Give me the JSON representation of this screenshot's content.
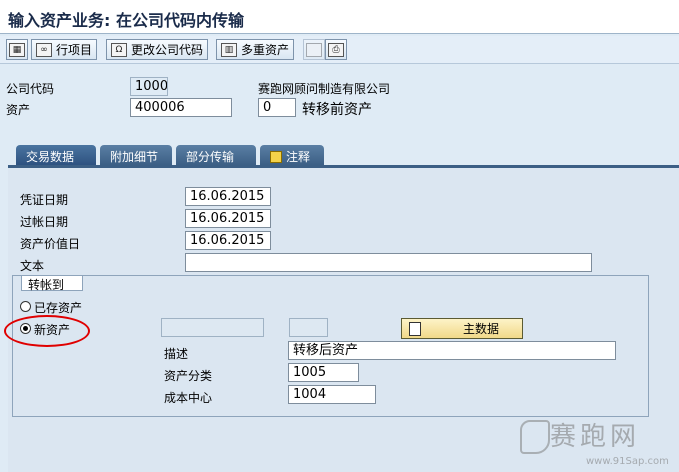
{
  "window": {
    "title": "输入资产业务: 在公司代码内传输"
  },
  "toolbar": {
    "items": [
      {
        "label": "",
        "icon": "overview-icon",
        "enabled": true
      },
      {
        "label": "行项目",
        "icon": "glasses-icon",
        "enabled": true
      },
      {
        "label": "更改公司代码",
        "icon": "headset-icon",
        "enabled": true
      },
      {
        "label": "多重资产",
        "icon": "grid-icon",
        "enabled": true
      },
      {
        "label": "",
        "icon": "disabled-icon",
        "enabled": false
      },
      {
        "label": "",
        "icon": "document-icon",
        "enabled": true
      }
    ]
  },
  "header": {
    "company_code_label": "公司代码",
    "company_code_value": "1000",
    "company_name": "赛跑网顾问制造有限公司",
    "asset_label": "资产",
    "asset_value": "400006",
    "sub_number_value": "0",
    "asset_before_transfer_label": "转移前资产"
  },
  "tabs": [
    {
      "label": "交易数据",
      "active": true
    },
    {
      "label": "附加细节",
      "active": false
    },
    {
      "label": "部分传输",
      "active": false
    },
    {
      "label": "注释",
      "active": false,
      "icon": "note-pencil-icon"
    }
  ],
  "transaction": {
    "document_date_label": "凭证日期",
    "document_date_value": "16.06.2015",
    "posting_date_label": "过帐日期",
    "posting_date_value": "16.06.2015",
    "asset_value_date_label": "资产价值日",
    "asset_value_date_value": "16.06.2015",
    "text_label": "文本",
    "text_value": ""
  },
  "transfer_to": {
    "group_title": "转帐到",
    "existing_asset_label": "已存资产",
    "new_asset_label": "新资产",
    "selected": "new_asset",
    "master_data_button": "主数据",
    "description_label": "描述",
    "description_value": "转移后资产",
    "asset_class_label": "资产分类",
    "asset_class_value": "1005",
    "cost_center_label": "成本中心",
    "cost_center_value": "1004"
  },
  "watermark": {
    "text": "赛跑网",
    "url": "www.91Sap.com"
  },
  "colors": {
    "annotation": "#e00000",
    "tab_active": "#2e5280",
    "master_button": "#f1d989"
  }
}
